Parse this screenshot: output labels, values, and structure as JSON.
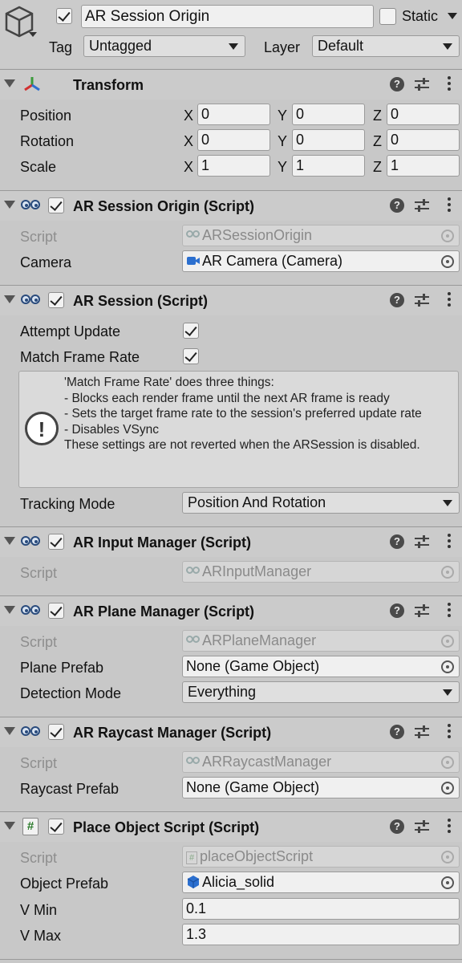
{
  "header": {
    "object_name": "AR Session Origin",
    "static_label": "Static",
    "tag_label": "Tag",
    "tag_value": "Untagged",
    "layer_label": "Layer",
    "layer_value": "Default"
  },
  "transform": {
    "title": "Transform",
    "rows": [
      {
        "label": "Position",
        "x": "0",
        "y": "0",
        "z": "0"
      },
      {
        "label": "Rotation",
        "x": "0",
        "y": "0",
        "z": "0"
      },
      {
        "label": "Scale",
        "x": "1",
        "y": "1",
        "z": "1"
      }
    ],
    "axis": {
      "x": "X",
      "y": "Y",
      "z": "Z"
    }
  },
  "ar_session_origin": {
    "title": "AR Session Origin (Script)",
    "script_label": "Script",
    "script_value": "ARSessionOrigin",
    "camera_label": "Camera",
    "camera_value": "AR Camera (Camera)"
  },
  "ar_session": {
    "title": "AR Session (Script)",
    "attempt_update_label": "Attempt Update",
    "attempt_update_checked": true,
    "match_frame_rate_label": "Match Frame Rate",
    "match_frame_rate_checked": true,
    "help_text": "'Match Frame Rate' does three things:\n- Blocks each render frame until the next AR frame is ready\n- Sets the target frame rate to the session's preferred update rate\n- Disables VSync\nThese settings are not reverted when the ARSession is disabled.",
    "tracking_mode_label": "Tracking Mode",
    "tracking_mode_value": "Position And Rotation"
  },
  "ar_input_manager": {
    "title": "AR Input Manager (Script)",
    "script_label": "Script",
    "script_value": "ARInputManager"
  },
  "ar_plane_manager": {
    "title": "AR Plane Manager (Script)",
    "script_label": "Script",
    "script_value": "ARPlaneManager",
    "plane_prefab_label": "Plane Prefab",
    "plane_prefab_value": "None (Game Object)",
    "detection_mode_label": "Detection Mode",
    "detection_mode_value": "Everything"
  },
  "ar_raycast_manager": {
    "title": "AR Raycast Manager (Script)",
    "script_label": "Script",
    "script_value": "ARRaycastManager",
    "raycast_prefab_label": "Raycast Prefab",
    "raycast_prefab_value": "None (Game Object)"
  },
  "place_object_script": {
    "title": "Place Object Script (Script)",
    "script_label": "Script",
    "script_value": "placeObjectScript",
    "object_prefab_label": "Object Prefab",
    "object_prefab_value": "Alicia_solid",
    "vmin_label": "V Min",
    "vmin_value": "0.1",
    "vmax_label": "V Max",
    "vmax_value": "1.3"
  },
  "icons": {
    "gameobject": "cube-icon",
    "transform": "transform-axes-icon",
    "script": "script-icon",
    "csharp": "hash-icon",
    "help": "help-icon",
    "presets": "sliders-icon",
    "menu": "kebab-icon",
    "picker": "object-picker-icon",
    "warning": "exclamation-icon",
    "camera": "camera-icon",
    "prefab": "prefab-cube-icon"
  },
  "colors": {
    "background": "#c8c8c8",
    "field": "#f0f0f0",
    "camera_icon": "#2b6fcf",
    "prefab_icon": "#2b6fcf",
    "transform_red": "#d23030",
    "transform_green": "#3a9a3a",
    "transform_blue": "#2f6fd0"
  }
}
